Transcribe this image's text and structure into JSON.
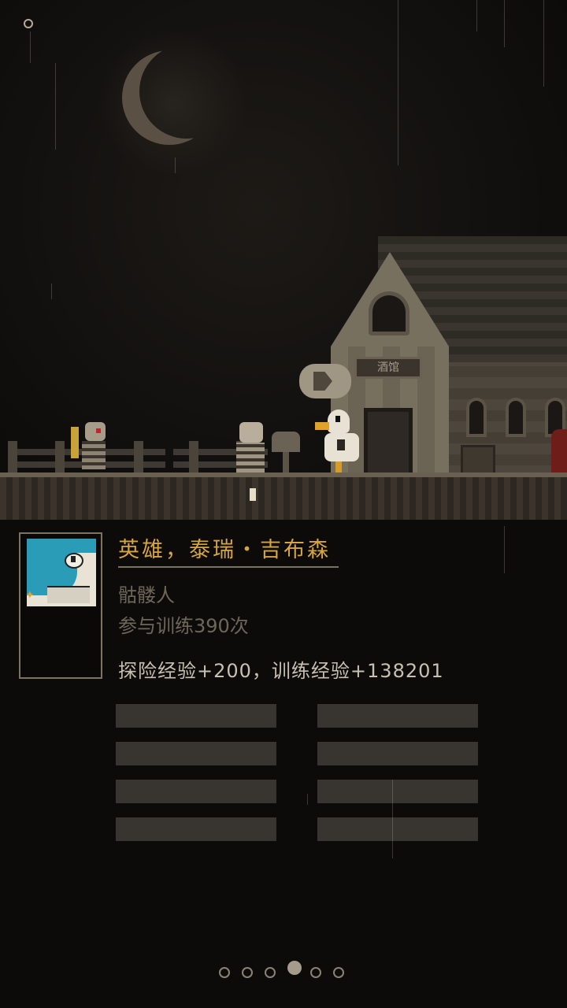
{
  "scene": {
    "sign_text": "酒馆"
  },
  "hero": {
    "title": "英雄，泰瑞・吉布森",
    "role": "骷髅人",
    "training_count": "参与训练390次",
    "experience": "探险经验+200，训练经验+138201"
  },
  "pager": {
    "total": 6,
    "active_index": 3
  },
  "colors": {
    "title": "#d6a53f",
    "hair": "#2b9cb8",
    "bars": "#383430"
  }
}
